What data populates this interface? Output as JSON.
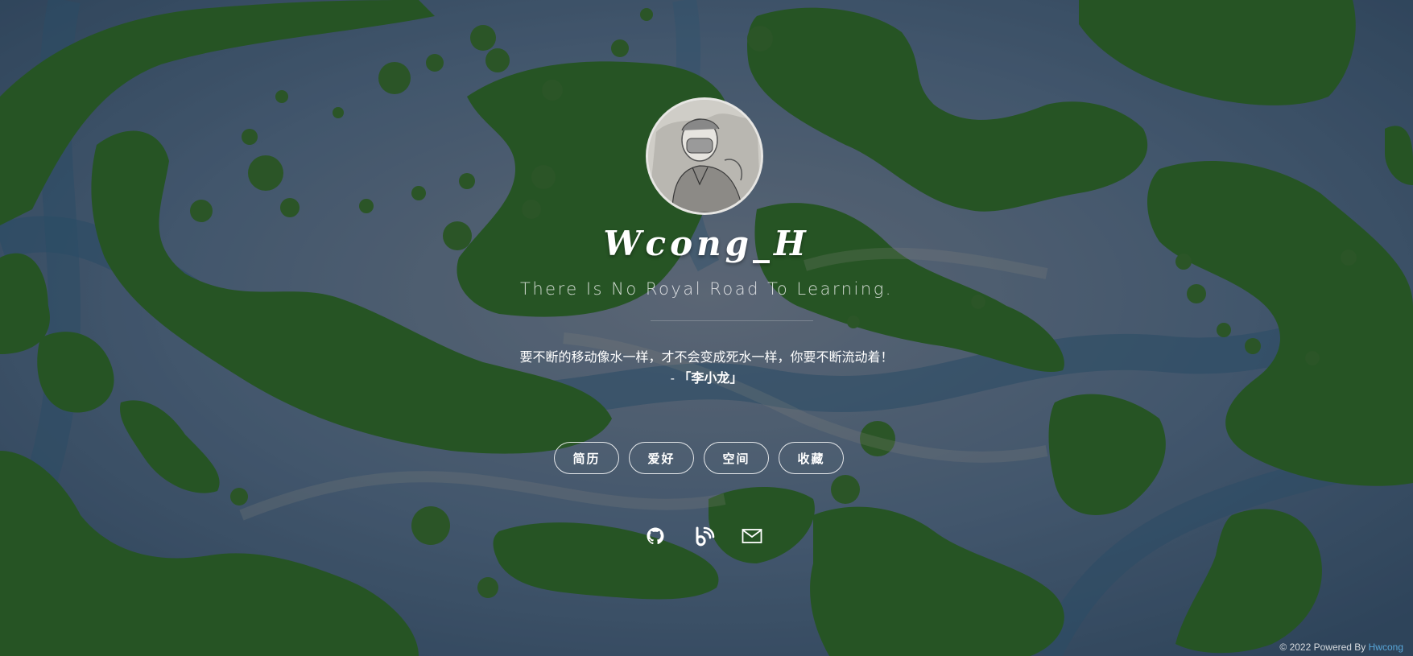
{
  "profile": {
    "site_name": "Wcong_H",
    "motto": "There Is No Royal Road To Learning.",
    "quote": "要不断的移动像水一样，才不会变成死水一样，你要不断流动着！",
    "quote_prefix": "- ",
    "quote_author": "「李小龙」",
    "avatar_icon": "avatar-portrait-icon"
  },
  "nav": {
    "items": [
      {
        "label": "简历"
      },
      {
        "label": "爱好"
      },
      {
        "label": "空间"
      },
      {
        "label": "收藏"
      }
    ]
  },
  "social": {
    "icons": [
      "github-icon",
      "blog-icon",
      "mail-icon"
    ]
  },
  "footer": {
    "text": "© 2022 Powered By ",
    "link": "Hwcong"
  },
  "colors": {
    "water": "#3f5a6e",
    "vegetation": "#2f6d23",
    "footer_link": "#58a6d8"
  }
}
